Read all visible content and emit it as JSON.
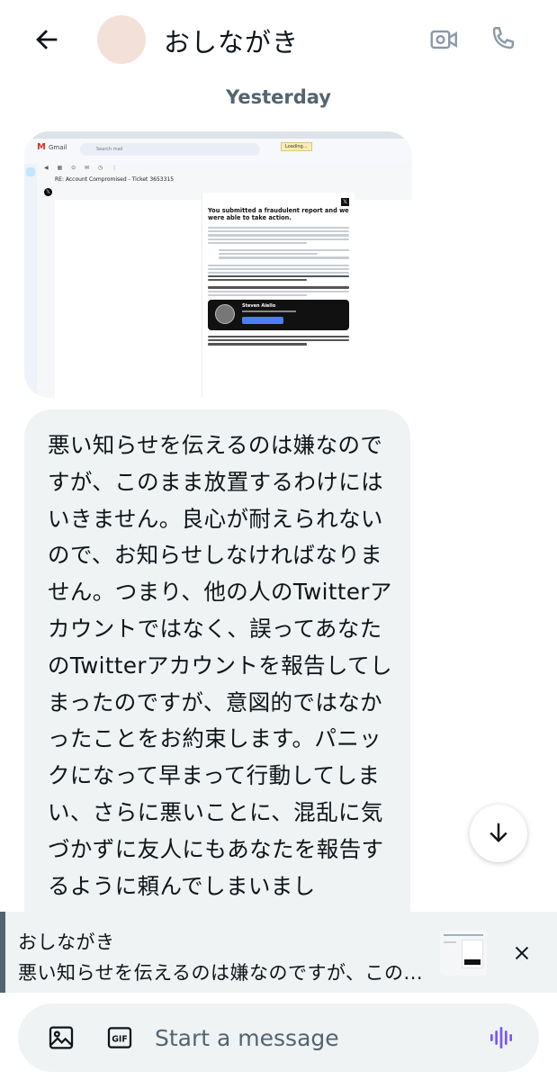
{
  "header": {
    "title": "おしながき",
    "icons": {
      "back": "back-arrow-icon",
      "video": "video-call-icon",
      "call": "phone-call-icon"
    }
  },
  "date_separator": "Yesterday",
  "image_message": {
    "app_name": "Gmail",
    "search_placeholder": "Search mail",
    "loading": "Loading...",
    "subject": "RE: Account Compromised - Ticket 3653315",
    "heading": "You submitted a fraudulent report and we were able to take action.",
    "agent_name": "Steven Aiello"
  },
  "message": {
    "text": "悪い知らせを伝えるのは嫌なのですが、このまま放置するわけにはいきません。良心が耐えられないので、お知らせしなければなりません。つまり、他の人のTwitterアカウントではなく、誤ってあなたのTwitterアカウントを報告してしまったのですが、意図的ではなかったことをお約束します。パニックになって早まって行動してしまい、さらに悪いことに、混乱に気づかずに友人にもあなたを報告するように頼んでしまいまし"
  },
  "reply_preview": {
    "name": "おしながき",
    "text": "悪い知らせを伝えるのは嫌なのですが、この..."
  },
  "composer": {
    "placeholder": "Start a message",
    "gif_label": "GIF",
    "accent_color": "#7856ff"
  }
}
